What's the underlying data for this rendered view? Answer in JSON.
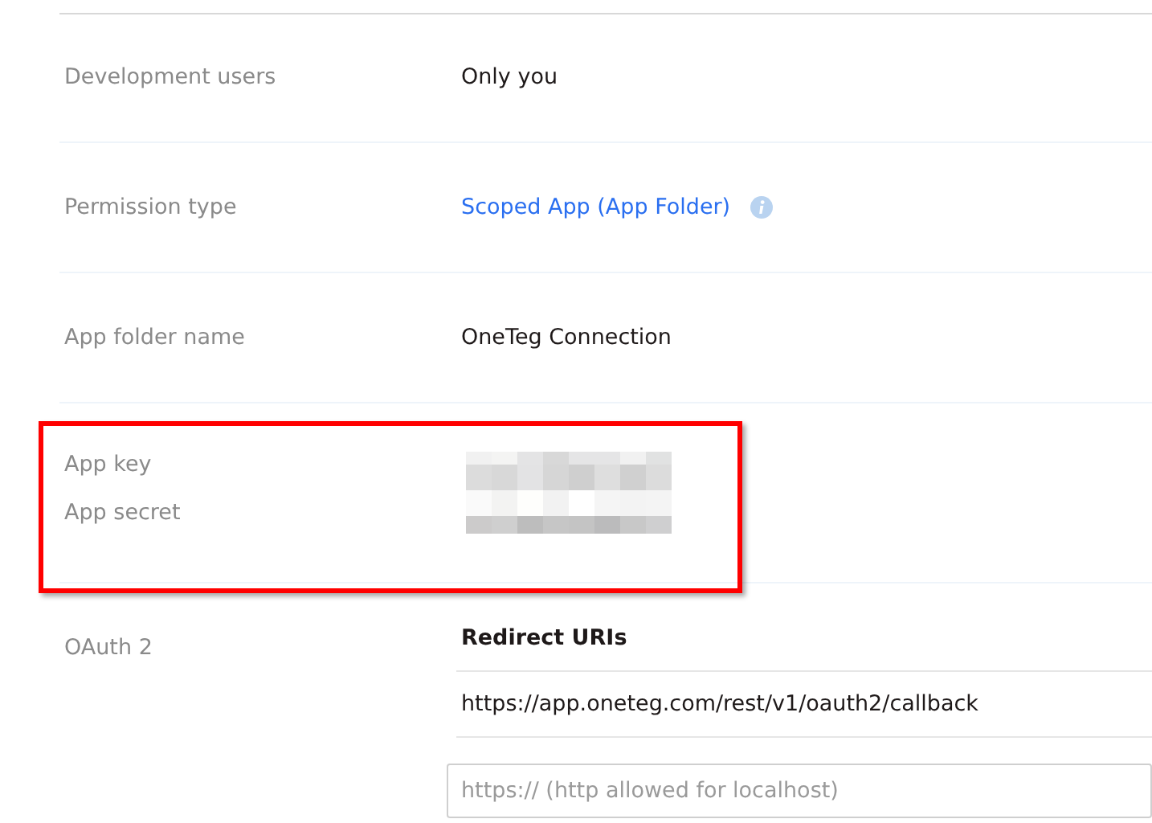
{
  "settings": [
    {
      "kind": "text",
      "label": "Development users",
      "value": "Only you"
    },
    {
      "kind": "link",
      "label": "Permission type",
      "value": "Scoped App (App Folder)",
      "info": true
    },
    {
      "kind": "text",
      "label": "App folder name",
      "value": "OneTeg Connection"
    },
    {
      "kind": "redacted",
      "labels": [
        "App key",
        "App secret"
      ],
      "highlighted": true
    }
  ],
  "oauth": {
    "label": "OAuth 2",
    "heading": "Redirect URIs",
    "uris": [
      "https://app.oneteg.com/rest/v1/oauth2/callback"
    ],
    "new_uri": {
      "placeholder": "https:// (http allowed for localhost)"
    }
  }
}
